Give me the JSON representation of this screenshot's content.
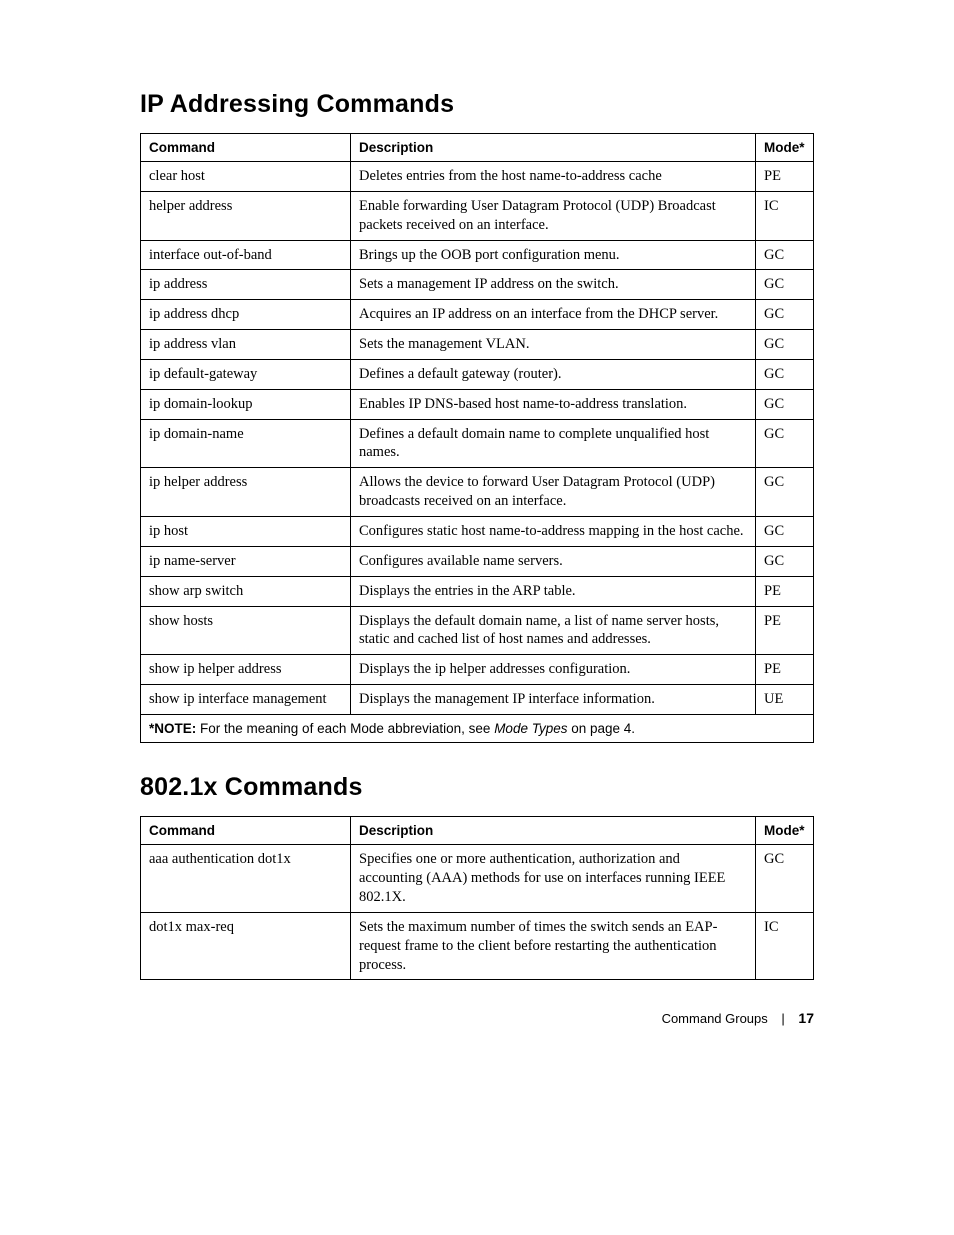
{
  "sections": [
    {
      "title": "IP Addressing Commands",
      "headers": {
        "c1": "Command",
        "c2": "Description",
        "c3": "Mode*"
      },
      "rows": [
        {
          "cmd": "clear host",
          "desc": "Deletes entries from the host name-to-address cache",
          "mode": "PE"
        },
        {
          "cmd": "helper address",
          "desc": "Enable forwarding User Datagram Protocol (UDP) Broadcast packets received on an interface.",
          "mode": "IC"
        },
        {
          "cmd": "interface out-of-band",
          "desc": "Brings up the OOB port configuration menu.",
          "mode": "GC"
        },
        {
          "cmd": "ip address",
          "desc": "Sets a management IP address on the switch.",
          "mode": "GC"
        },
        {
          "cmd": "ip address dhcp",
          "desc": "Acquires an IP address on an interface from the DHCP server.",
          "mode": "GC"
        },
        {
          "cmd": "ip address vlan",
          "desc": "Sets the management VLAN.",
          "mode": "GC"
        },
        {
          "cmd": "ip default-gateway",
          "desc": "Defines a default gateway (router).",
          "mode": "GC"
        },
        {
          "cmd": "ip domain-lookup",
          "desc": "Enables IP DNS-based host name-to-address translation.",
          "mode": "GC"
        },
        {
          "cmd": "ip domain-name",
          "desc": "Defines a default domain name to complete unqualified host names.",
          "mode": "GC"
        },
        {
          "cmd": "ip helper address",
          "desc": "Allows the device to forward User Datagram Protocol (UDP) broadcasts received on an interface.",
          "mode": "GC"
        },
        {
          "cmd": "ip host",
          "desc": "Configures static host name-to-address mapping in the host cache.",
          "mode": "GC"
        },
        {
          "cmd": "ip name-server",
          "desc": "Configures available name servers.",
          "mode": "GC"
        },
        {
          "cmd": "show arp switch",
          "desc": "Displays the entries in the ARP table.",
          "mode": "PE"
        },
        {
          "cmd": "show hosts",
          "desc": "Displays the default domain name, a list of name server hosts, static and cached list of host names and addresses.",
          "mode": "PE"
        },
        {
          "cmd": "show ip helper address",
          "desc": "Displays the ip helper addresses configuration.",
          "mode": "PE"
        },
        {
          "cmd": "show ip interface management",
          "desc": "Displays the management IP interface information.",
          "mode": "UE"
        }
      ],
      "note": {
        "bold": "*NOTE:",
        "text1": " For the meaning of each Mode abbreviation, see ",
        "italic": "Mode Types",
        "text2": " on page 4."
      }
    },
    {
      "title": "802.1x Commands",
      "headers": {
        "c1": "Command",
        "c2": "Description",
        "c3": "Mode*"
      },
      "rows": [
        {
          "cmd": "aaa authentication dot1x",
          "desc": "Specifies one or more authentication, authorization and accounting (AAA) methods for use on interfaces running IEEE 802.1X.",
          "mode": "GC"
        },
        {
          "cmd": "dot1x max-req",
          "desc": "Sets the maximum number of times the switch sends an EAP-request frame to the client before restarting the authentication process.",
          "mode": "IC"
        }
      ]
    }
  ],
  "footer": {
    "section": "Command Groups",
    "page": "17"
  }
}
